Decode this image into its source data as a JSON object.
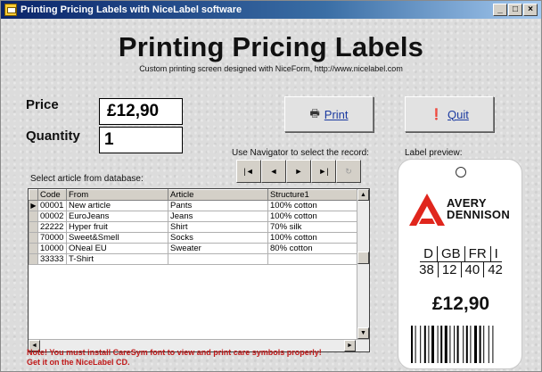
{
  "window": {
    "title": "Printing Pricing Labels with NiceLabel software",
    "controls": [
      "_",
      "□",
      "×"
    ]
  },
  "header": {
    "title": "Printing Pricing Labels",
    "subtitle": "Custom printing screen designed with NiceForm, http://www.nicelabel.com"
  },
  "form": {
    "price_label": "Price",
    "price_value": "£12,90",
    "quantity_label": "Quantity",
    "quantity_value": "1"
  },
  "buttons": {
    "print": {
      "label": "Print",
      "icon": "printer-icon"
    },
    "quit": {
      "label": "Quit",
      "icon": "exclamation-icon"
    }
  },
  "navigator": {
    "hint": "Use Navigator to select the record:",
    "buttons": [
      {
        "name": "first",
        "glyph": "|◄"
      },
      {
        "name": "prior",
        "glyph": "◄"
      },
      {
        "name": "next",
        "glyph": "►"
      },
      {
        "name": "last",
        "glyph": "►|"
      },
      {
        "name": "refresh",
        "glyph": "↻"
      }
    ]
  },
  "database": {
    "label": "Select article from database:",
    "columns": [
      "Code",
      "From",
      "Article",
      "Structure1"
    ],
    "rows": [
      [
        "00001",
        "New article",
        "Pants",
        "100% cotton"
      ],
      [
        "00002",
        "EuroJeans",
        "Jeans",
        "100% cotton"
      ],
      [
        "22222",
        "Hyper fruit",
        "Shirt",
        "70% silk"
      ],
      [
        "70000",
        "Sweet&Smell",
        "Socks",
        "100% cotton"
      ],
      [
        "10000",
        "ONeal EU",
        "Sweater",
        "80% cotton"
      ],
      [
        "33333",
        "T-Shirt",
        "",
        ""
      ]
    ],
    "current_row_indicator": "▶"
  },
  "note": {
    "line1": "Note! You must install CareSym font to view and print care symbols properly!",
    "line2": "Get it on the NiceLabel CD."
  },
  "preview": {
    "label": "Label preview:",
    "brand_line1": "AVERY",
    "brand_line2": "DENNISON",
    "size_codes": [
      "D",
      "GB",
      "FR",
      "I"
    ],
    "size_values": [
      "38",
      "12",
      "40",
      "42"
    ],
    "price": "£12,90"
  },
  "colors": {
    "title_bar_start": "#0a246a",
    "note_text": "#c01818",
    "link_text": "#1b3aa0",
    "logo_red": "#e0261d"
  }
}
